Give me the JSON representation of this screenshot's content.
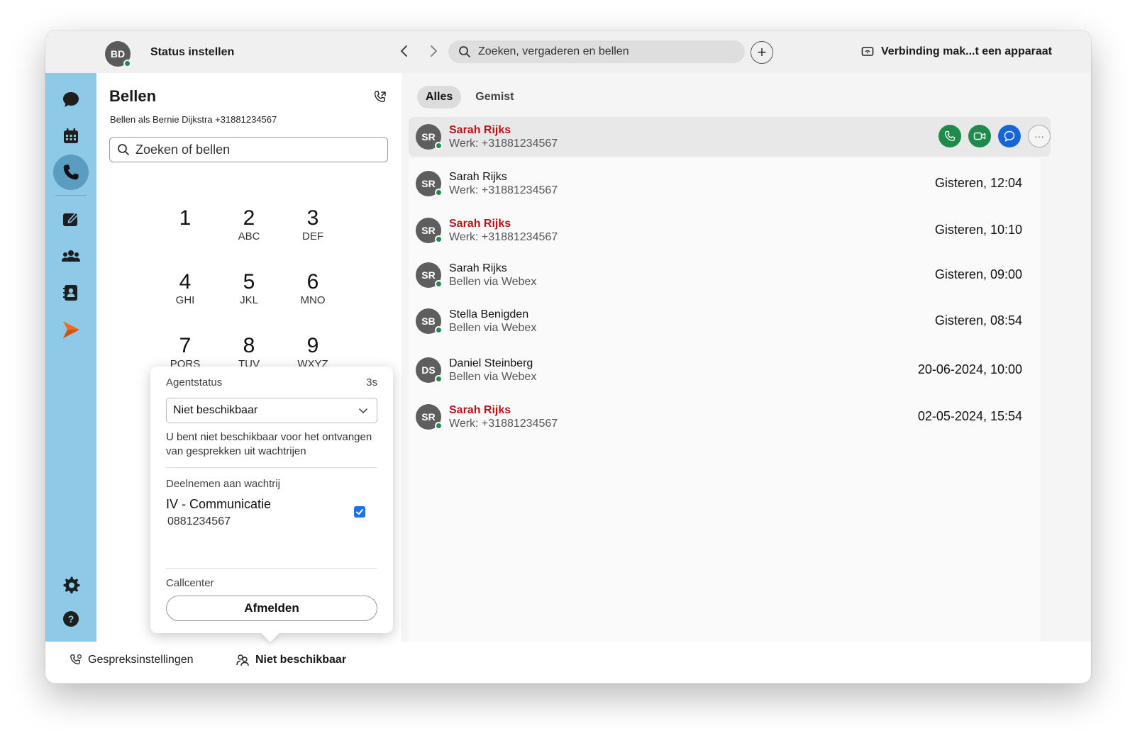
{
  "topbar": {
    "avatar_initials": "BD",
    "status_title": "Status instellen",
    "search_placeholder": "Zoeken, vergaderen en bellen",
    "add_label": "+",
    "connect_label": "Verbinding mak...t een apparaat"
  },
  "rail": {
    "items": [
      "chat-icon",
      "calendar-icon",
      "phone-icon",
      "edit-icon",
      "teams-icon",
      "contacts-icon",
      "webex-icon",
      "settings-icon",
      "help-icon"
    ],
    "active": "phone-icon",
    "active_color": "#5a9dc0",
    "rail_color": "#8ec9e8"
  },
  "calls": {
    "title": "Bellen",
    "subtitle": "Bellen als Bernie Dijkstra +31881234567",
    "search_placeholder": "Zoeken of bellen",
    "keys": [
      {
        "num": "1",
        "letters": ""
      },
      {
        "num": "2",
        "letters": "ABC"
      },
      {
        "num": "3",
        "letters": "DEF"
      },
      {
        "num": "4",
        "letters": "GHI"
      },
      {
        "num": "5",
        "letters": "JKL"
      },
      {
        "num": "6",
        "letters": "MNO"
      },
      {
        "num": "7",
        "letters": "PQRS"
      },
      {
        "num": "8",
        "letters": "TUV"
      },
      {
        "num": "9",
        "letters": "WXYZ"
      }
    ]
  },
  "popup": {
    "agent_label": "Agentstatus",
    "timer": "3s",
    "selected_status": "Niet beschikbaar",
    "description": "U bent niet beschikbaar voor het ontvangen van gesprekken uit wachtrijen",
    "queue_section": "Deelnemen aan wachtrij",
    "queue_name": "IV - Communicatie",
    "queue_number": "0881234567",
    "queue_checked": true,
    "callcenter_label": "Callcenter",
    "signout_label": "Afmelden"
  },
  "bottombar": {
    "settings_label": "Gespreksinstellingen",
    "status_label": "Niet beschikbaar"
  },
  "history": {
    "tabs": [
      {
        "label": "Alles",
        "active": true
      },
      {
        "label": "Gemist",
        "active": false
      }
    ],
    "rows": [
      {
        "initials": "SR",
        "name": "Sarah Rijks",
        "sub": "Werk: +31881234567",
        "time": "",
        "missed": true,
        "selected": true
      },
      {
        "initials": "SR",
        "name": "Sarah Rijks",
        "sub": "Werk: +31881234567",
        "time": "Gisteren, 12:04",
        "missed": false,
        "selected": false
      },
      {
        "initials": "SR",
        "name": "Sarah Rijks",
        "sub": "Werk: +31881234567",
        "time": "Gisteren, 10:10",
        "missed": true,
        "selected": false
      },
      {
        "initials": "SR",
        "name": "Sarah Rijks",
        "sub": "Bellen via Webex",
        "time": "Gisteren, 09:00",
        "missed": false,
        "selected": false
      },
      {
        "initials": "SB",
        "name": "Stella Benigden",
        "sub": "Bellen via Webex",
        "time": "Gisteren, 08:54",
        "missed": false,
        "selected": false
      },
      {
        "initials": "DS",
        "name": "Daniel Steinberg",
        "sub": "Bellen via Webex",
        "time": "20-06-2024, 10:00",
        "missed": false,
        "selected": false
      },
      {
        "initials": "SR",
        "name": "Sarah Rijks",
        "sub": "Werk: +31881234567",
        "time": "02-05-2024, 15:54",
        "missed": true,
        "selected": false
      }
    ],
    "actions": [
      "phone-icon",
      "video-icon",
      "chat-icon",
      "more-icon"
    ],
    "missed_color": "#b8141a",
    "call_color": "#1e8a4c",
    "chat_color": "#1766d6"
  }
}
